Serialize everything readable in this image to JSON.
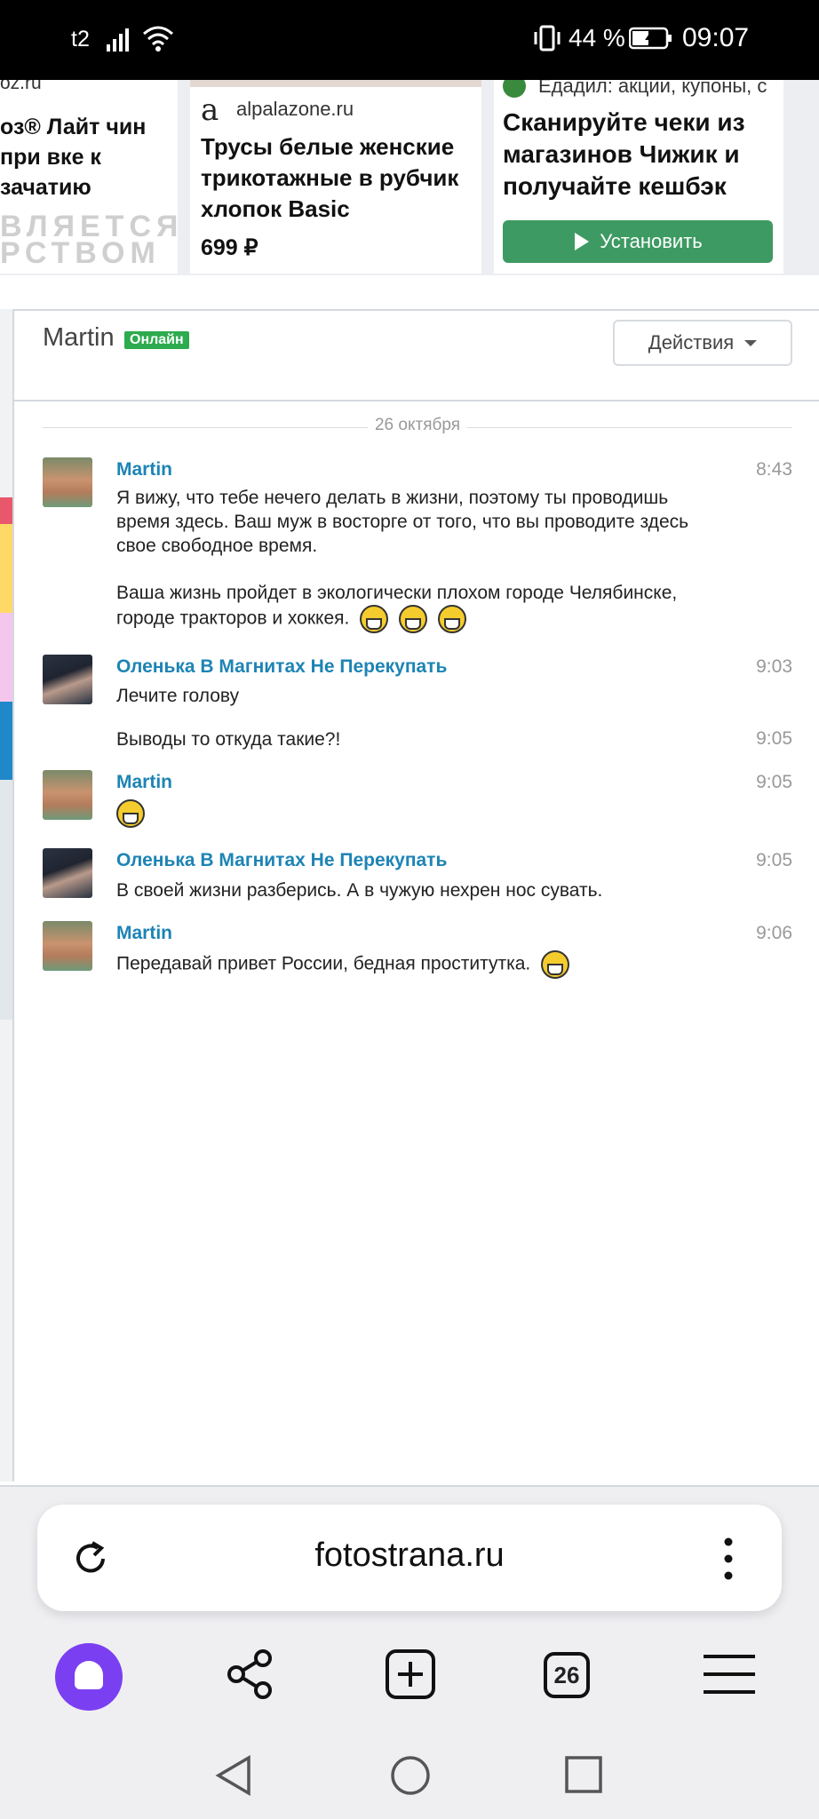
{
  "status_bar": {
    "carrier": "t2",
    "battery_percent": "44 %",
    "time": "09:07"
  },
  "ads": [
    {
      "domain": "oz.ru",
      "title": "оз® Лайт чин при вке к зачатию",
      "watermark": "ВЛЯЕТСЯ РСТВОМ"
    },
    {
      "domain": "alpalazone.ru",
      "title": "Трусы белые женские трикотажные в рубчик хлопок Basic",
      "price": "699 ₽"
    },
    {
      "domain": "Едадил: акции, купоны, с",
      "title": "Сканируйте чеки из магазинов Чижик и получайте кешбэк",
      "button": "Установить"
    }
  ],
  "chat": {
    "name": "Martin",
    "status": "Онлайн",
    "actions_label": "Действия",
    "date": "26 октября",
    "messages": [
      {
        "author": "Martin",
        "time": "8:43",
        "line1": "Я вижу, что тебе нечего делать в жизни, поэтому ты проводишь время здесь. Ваш муж в восторге от того, что вы проводите здесь свое свободное время.",
        "line2": "Ваша жизнь пройдет в экологически плохом городе Челябинске, городе тракторов и хоккея."
      },
      {
        "author": "Оленька В Магнитах Не Перекупать",
        "time": "9:03",
        "text": "Лечите голову"
      },
      {
        "time": "9:05",
        "text": "Выводы то откуда такие?!"
      },
      {
        "author": "Martin",
        "time": "9:05",
        "text": ""
      },
      {
        "author": "Оленька В Магнитах Не Перекупать",
        "time": "9:05",
        "text": "В своей жизни разберись. А в чужую нехрен нос сувать."
      },
      {
        "author": "Martin",
        "time": "9:06",
        "text": "Передавай привет России, бедная проститутка."
      }
    ]
  },
  "browser": {
    "url": "fotostrana.ru",
    "tabs_count": "26"
  }
}
